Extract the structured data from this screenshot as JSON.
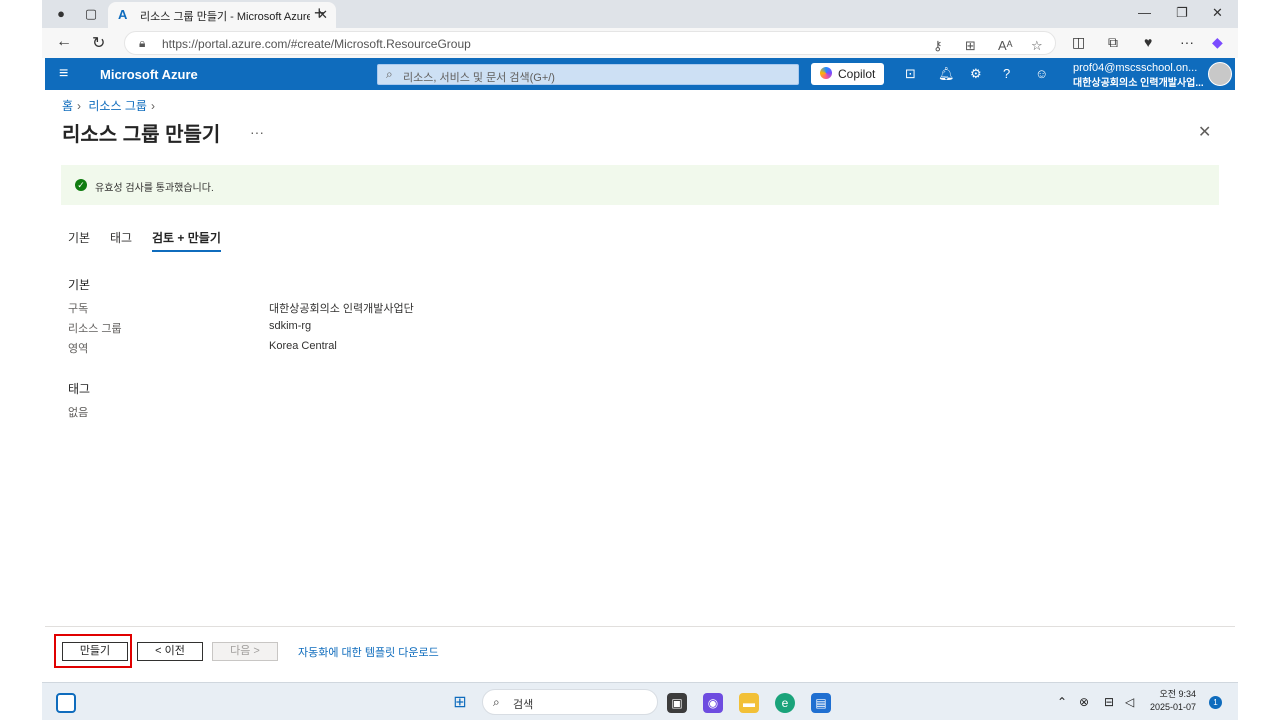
{
  "browser": {
    "tab_title": "리소스 그룹 만들기 - Microsoft Azure",
    "url": "https://portal.azure.com/#create/Microsoft.ResourceGroup"
  },
  "azure_header": {
    "brand": "Microsoft Azure",
    "search_placeholder": "리소스, 서비스 및 문서 검색(G+/)",
    "copilot_label": "Copilot",
    "account_email": "prof04@mscsschool.on...",
    "account_org": "대한상공회의소 인력개발사업..."
  },
  "breadcrumb": [
    "홈",
    "리소스 그룹"
  ],
  "page": {
    "title": "리소스 그룹 만들기",
    "more": "···"
  },
  "banner": {
    "text": "유효성 검사를 통과했습니다."
  },
  "tabs": [
    {
      "label": "기본",
      "active": false
    },
    {
      "label": "태그",
      "active": false
    },
    {
      "label": "검토 + 만들기",
      "active": true
    }
  ],
  "review": {
    "basics_heading": "기본",
    "basics": [
      {
        "key": "구독",
        "value": "대한상공회의소 인력개발사업단"
      },
      {
        "key": "리소스 그룹",
        "value": "sdkim-rg"
      },
      {
        "key": "영역",
        "value": "Korea Central"
      }
    ],
    "tags_heading": "태그",
    "tags_value": "없음"
  },
  "footer": {
    "create_label": "만들기",
    "prev_label": "< 이전",
    "next_label": "다음 >",
    "template_link": "자동화에 대한 템플릿 다운로드"
  },
  "taskbar": {
    "search_label": "검색",
    "time": "오전 9:34",
    "date": "2025-01-07",
    "notifications": "1"
  },
  "colors": {
    "azure_blue": "#0f6cbd",
    "success_green": "#107c10",
    "highlight_red": "#e00000"
  }
}
